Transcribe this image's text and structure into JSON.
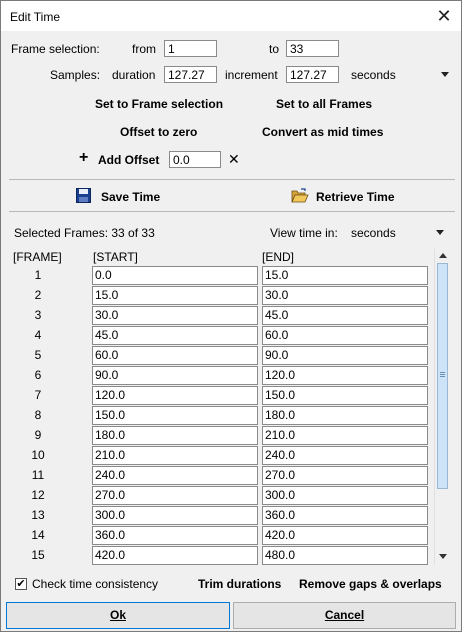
{
  "window": {
    "title": "Edit Time"
  },
  "frame_selection": {
    "label": "Frame selection:",
    "from_label": "from",
    "from_value": "1",
    "to_label": "to",
    "to_value": "33"
  },
  "samples": {
    "label": "Samples:",
    "duration_label": "duration",
    "duration_value": "127.27",
    "increment_label": "increment",
    "increment_value": "127.27",
    "unit": "seconds"
  },
  "actions": {
    "set_to_frame_selection": "Set to Frame selection",
    "set_to_all_frames": "Set to all Frames",
    "offset_to_zero": "Offset to zero",
    "convert_as_mid_times": "Convert as mid times",
    "add_offset_label": "Add Offset",
    "add_offset_value": "0.0"
  },
  "file_actions": {
    "save": "Save Time",
    "retrieve": "Retrieve Time"
  },
  "status": {
    "selected_frames": "Selected Frames: 33 of 33",
    "view_time_label": "View time in:",
    "view_time_unit": "seconds"
  },
  "table": {
    "headers": [
      "[FRAME]",
      "[START]",
      "[END]"
    ],
    "rows": [
      {
        "frame": "1",
        "start": "0.0",
        "end": "15.0"
      },
      {
        "frame": "2",
        "start": "15.0",
        "end": "30.0"
      },
      {
        "frame": "3",
        "start": "30.0",
        "end": "45.0"
      },
      {
        "frame": "4",
        "start": "45.0",
        "end": "60.0"
      },
      {
        "frame": "5",
        "start": "60.0",
        "end": "90.0"
      },
      {
        "frame": "6",
        "start": "90.0",
        "end": "120.0"
      },
      {
        "frame": "7",
        "start": "120.0",
        "end": "150.0"
      },
      {
        "frame": "8",
        "start": "150.0",
        "end": "180.0"
      },
      {
        "frame": "9",
        "start": "180.0",
        "end": "210.0"
      },
      {
        "frame": "10",
        "start": "210.0",
        "end": "240.0"
      },
      {
        "frame": "11",
        "start": "240.0",
        "end": "270.0"
      },
      {
        "frame": "12",
        "start": "270.0",
        "end": "300.0"
      },
      {
        "frame": "13",
        "start": "300.0",
        "end": "360.0"
      },
      {
        "frame": "14",
        "start": "360.0",
        "end": "420.0"
      },
      {
        "frame": "15",
        "start": "420.0",
        "end": "480.0"
      }
    ]
  },
  "footer": {
    "check_label": "Check time consistency",
    "check_checked": true,
    "trim_durations": "Trim durations",
    "remove_gaps": "Remove gaps & overlaps",
    "ok": "Ok",
    "cancel": "Cancel"
  },
  "icons": {
    "close": "close-icon",
    "save": "floppy-disk-icon",
    "retrieve": "open-folder-icon",
    "add": "plus-icon",
    "clear": "x-icon",
    "dropdown": "chevron-down-icon",
    "check": "checkmark-icon"
  }
}
